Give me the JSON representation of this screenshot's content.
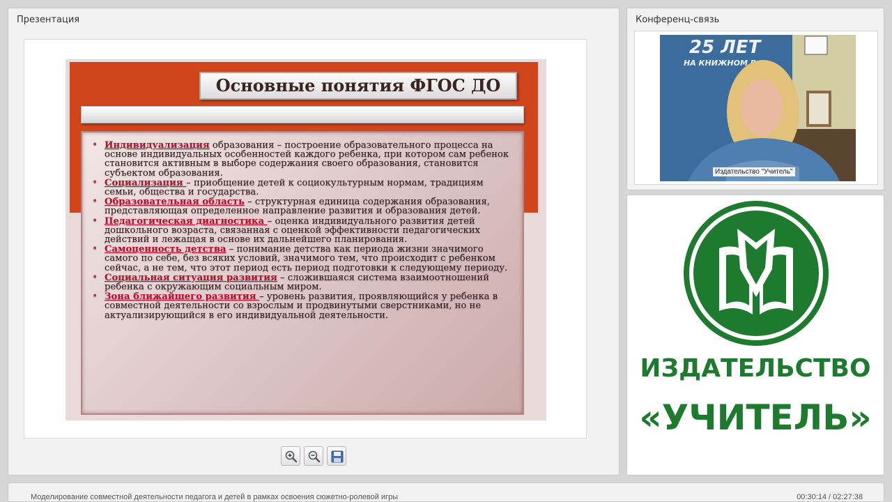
{
  "presentation": {
    "panel_title": "Презентация",
    "slide": {
      "title": "Основные понятия ФГОС ДО",
      "items": [
        {
          "term": "Индивидуализация",
          "text": " образования – построение образовательного процесса на основе индивидуальных особенностей каждого ребенка, при котором сам ребенок становится активным в выборе содержания своего образования, становится субъектом образования."
        },
        {
          "term": "Социализация ",
          "text": "– приобщение детей к социокультурным нормам, традициям семьи, общества и государства."
        },
        {
          "term": "Образовательная область",
          "text": " – структурная единица содержания образования, представляющая определенное направление развития и образования детей."
        },
        {
          "term": "Педагогическая диагностика ",
          "text": "– оценка индивидуального развития детей дошкольного возраста, связанная с оценкой эффективности педагогических действий и лежащая в основе их дальнейшего планирования."
        },
        {
          "term": "Самоценность детства",
          "text": " – понимание детства как периода жизни значимого самого по себе, без всяких условий, значимого тем, что происходит с ребенком сейчас, а не тем, что этот период есть период подготовки к следующему периоду."
        },
        {
          "term": "Социальная ситуация развития",
          "text": " – сложившаяся система взаимоотношений ребенка с окружающим социальным миром."
        },
        {
          "term": "Зона ближайшего развития ",
          "text": "– уровень развития, проявляющийся у ребенка в совместной деятельности со взрослым и продвинутыми сверстниками, но не актуализирующийся в его индивидуальной деятельности."
        }
      ]
    },
    "toolbar": {
      "zoom_in_icon": "zoom-in-icon",
      "zoom_out_icon": "zoom-out-icon",
      "save_icon": "save-icon"
    }
  },
  "conference": {
    "panel_title": "Конференц-связь",
    "video_caption": "Издательство \"Учитель\"",
    "background_sign": "25 ЛЕТ НА КНИЖНОМ Р..."
  },
  "logo": {
    "line1": "ИЗДАТЕЛЬСТВО",
    "line2": "«УЧИТЕЛЬ»",
    "color": "#1e7a2e"
  },
  "footer": {
    "title": "Моделирование совместной деятельности педагога и детей в рамках освоения сюжетно-ролевой игры",
    "time": "00:30:14 / 02:27:38"
  },
  "colors": {
    "slide_accent": "#d0451b",
    "term_color": "#b8102a"
  }
}
